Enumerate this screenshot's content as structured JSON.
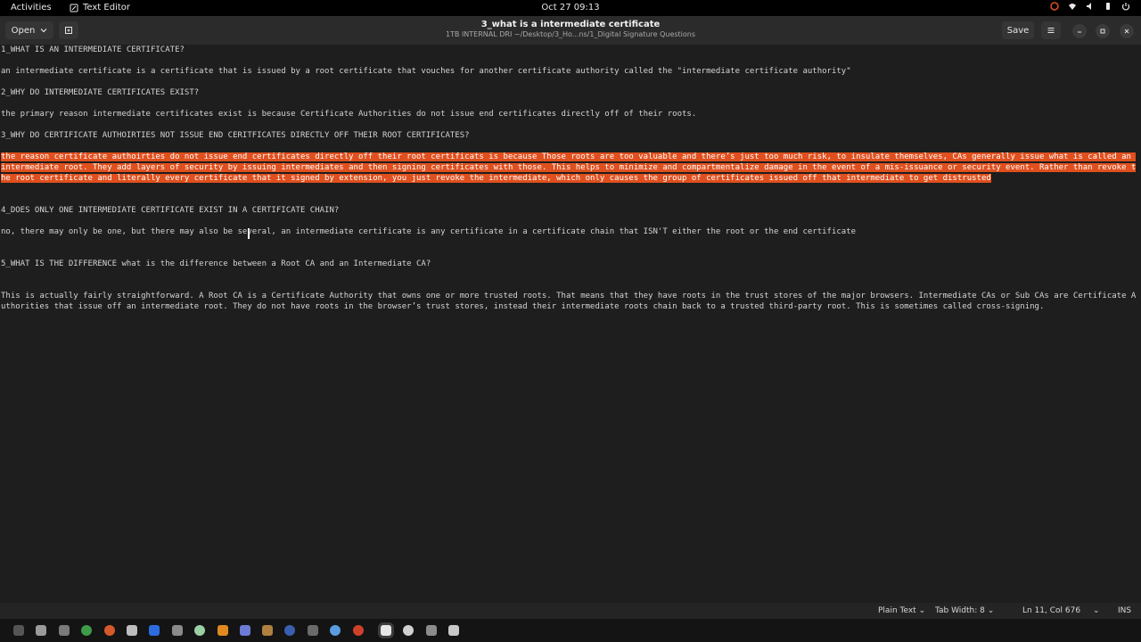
{
  "topbar": {
    "activities": "Activities",
    "app_name": "Text Editor",
    "clock": "Oct 27  09:13"
  },
  "headerbar": {
    "open_label": "Open",
    "title": "3_what is a intermediate certificate",
    "subtitle": "1TB INTERNAL DRI ~/Desktop/3_Ho...ns/1_Digital Signature Questions",
    "save_label": "Save"
  },
  "document": {
    "lines": [
      "1_WHAT IS AN INTERMEDIATE CERTIFICATE?",
      "an intermediate certificate is a certificate that is issued by a root certificate that vouches for another certificate authority called the \"intermediate certificate authority\"",
      "2_WHY DO INTERMEDIATE CERTIFICATES EXIST?",
      "the primary reason intermediate certificates exist is because Certificate Authorities do not issue end certificates directly off of their roots.",
      "3_WHY DO CERTIFICATE AUTHOIRTIES NOT ISSUE END CERITFICATES DIRECTLY OFF THEIR ROOT CERTIFICATES?",
      "the reason certificate authoirties do not issue end certificates directly off their root certificats is because Those roots are too valuable and there’s just too much risk, to insulate themselves, CAs generally issue what is called an intermediate root. They add layers of security by issuing intermediates and then signing certificates with those. This helps to minimize and compartmentalize damage in the event of a mis-issuance or security event. Rather than revoke the root certificate and literally every certificate that it signed by extension, you just revoke the intermediate, which only causes the group of certificates issued off that intermediate to get distrusted",
      "4_DOES ONLY ONE INTERMEDIATE CERTIFICATE EXIST IN A CERTIFICATE CHAIN?",
      "no, there may only be one, but there may also be several, an intermediate certificate is any certificate in a certificate chain that ISN'T either the root or the end certificate",
      "5_WHAT IS THE DIFFERENCE what is the difference between a Root CA and an Intermediate CA?",
      "This is actually fairly straightforward. A Root CA is a Certificate Authority that owns one or more trusted roots. That means that they have roots in the trust stores of the major browsers. Intermediate CAs or Sub CAs are Certificate Authorities that issue off an intermediate root. They do not have roots in the browser’s trust stores, instead their intermediate roots chain back to a trusted third-party root. This is sometimes called cross-signing."
    ]
  },
  "statusbar": {
    "language": "Plain Text",
    "tab_width": "Tab Width: 8",
    "position": "Ln 11, Col 676",
    "mode": "INS"
  },
  "colors": {
    "selection": "#e0501e",
    "background": "#1e1e1e"
  },
  "icons": {
    "open_dropdown": "chevron-down-icon",
    "new_tab": "new-tab-icon",
    "menu": "hamburger-menu-icon",
    "minimize": "minimize-icon",
    "maximize": "maximize-icon",
    "close": "close-icon"
  }
}
